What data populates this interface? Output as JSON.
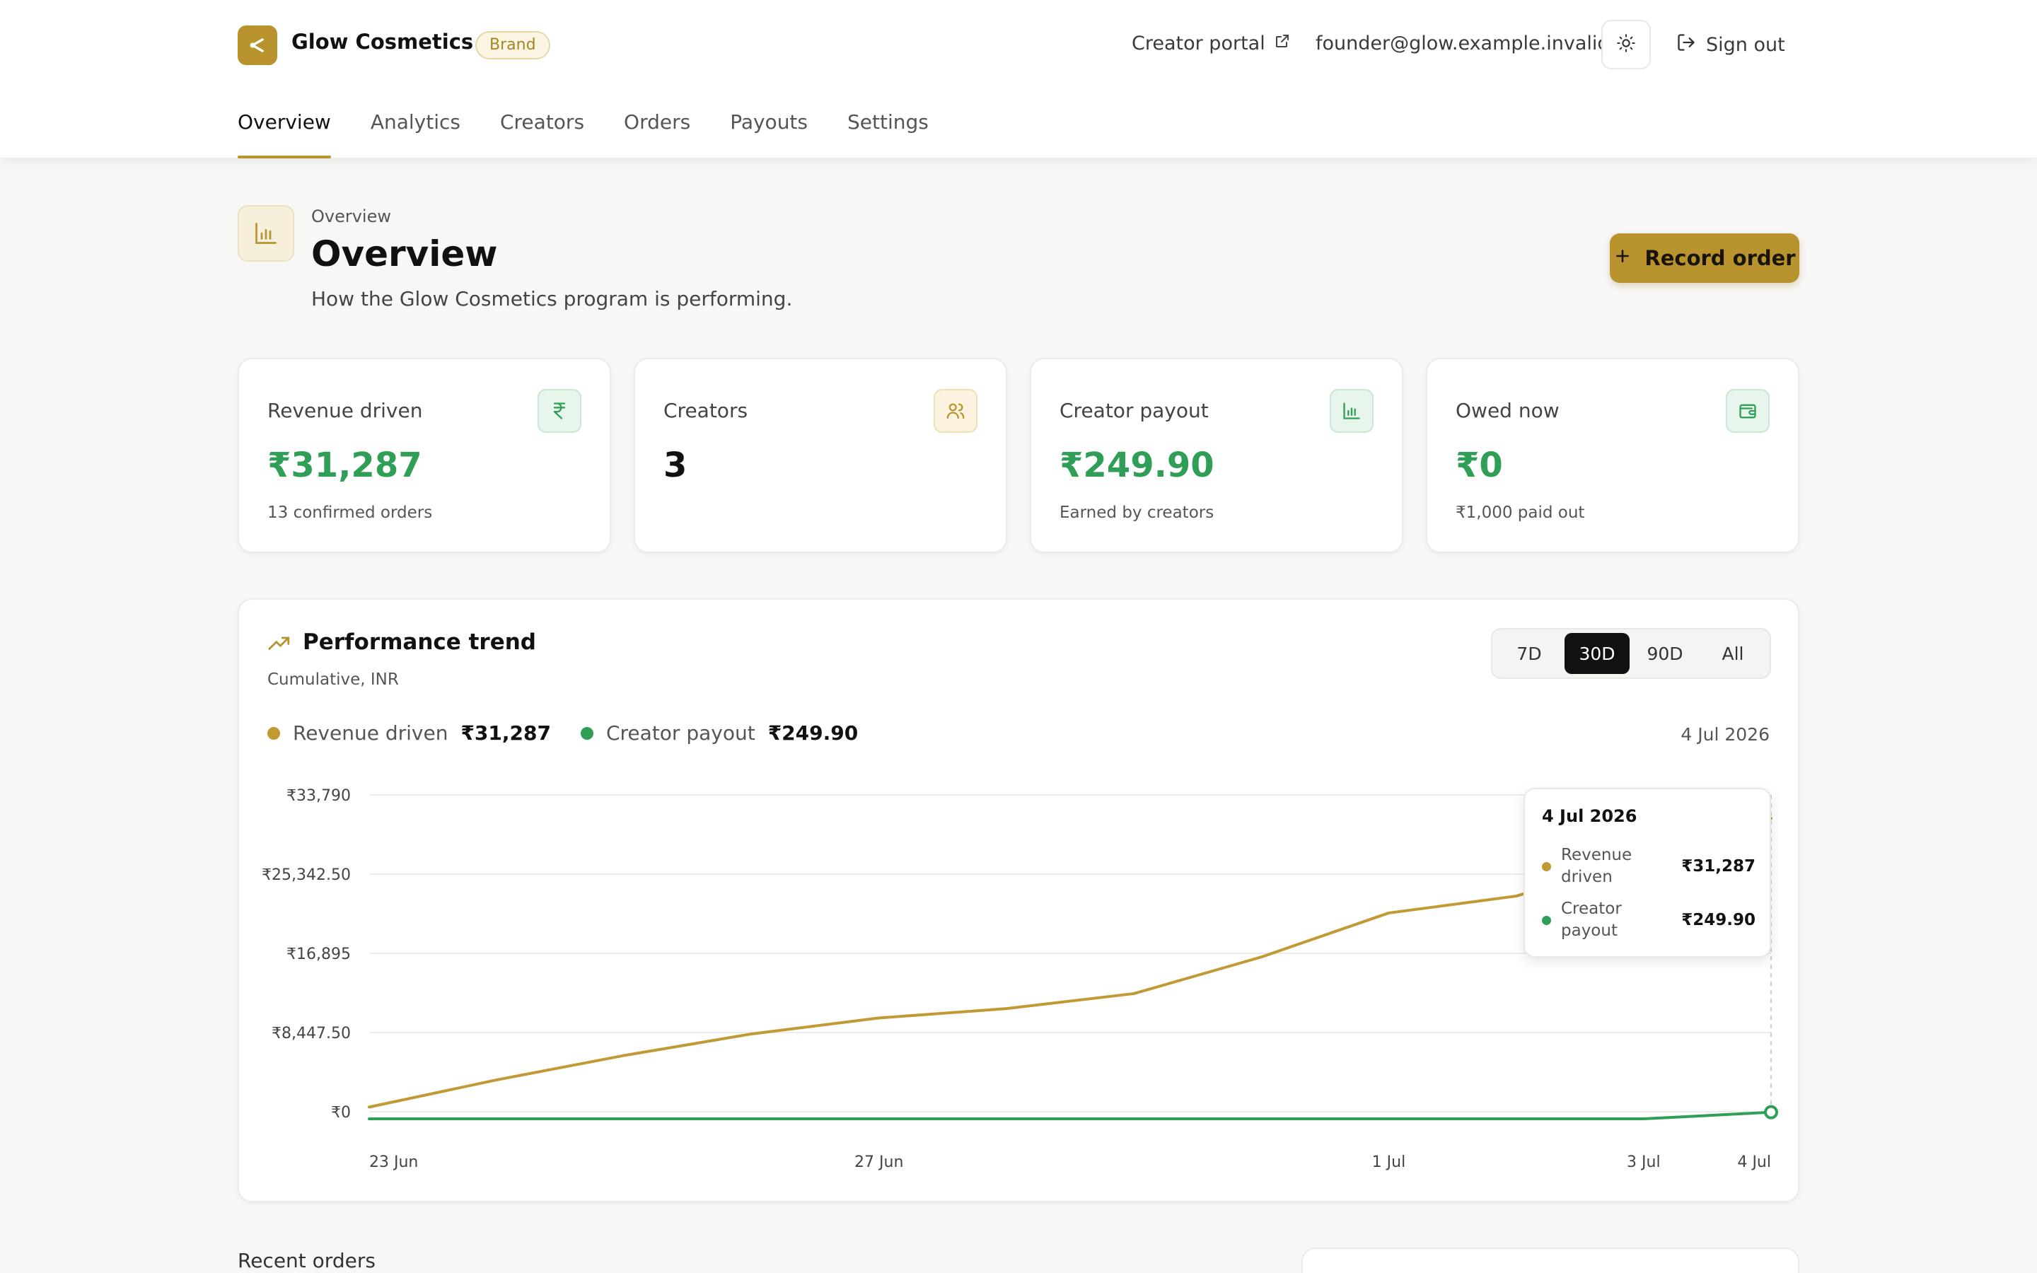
{
  "header": {
    "brand_name": "Glow Cosmetics",
    "brand_badge": "Brand",
    "creator_portal": "Creator portal",
    "user_email": "founder@glow.example.invalid",
    "sign_out": "Sign out",
    "accent_color": "#b8932e"
  },
  "tabs": [
    {
      "label": "Overview",
      "active": true
    },
    {
      "label": "Analytics",
      "active": false
    },
    {
      "label": "Creators",
      "active": false
    },
    {
      "label": "Orders",
      "active": false
    },
    {
      "label": "Payouts",
      "active": false
    },
    {
      "label": "Settings",
      "active": false
    }
  ],
  "page": {
    "breadcrumb": "Overview",
    "title": "Overview",
    "subtitle": "How the Glow Cosmetics program is performing.",
    "record_button": "Record order"
  },
  "stats": [
    {
      "label": "Revenue driven",
      "value": "₹31,287",
      "note": "13 confirmed orders",
      "icon": "rupee-icon"
    },
    {
      "label": "Creators",
      "value": "3",
      "note": "",
      "icon": "users-icon"
    },
    {
      "label": "Creator payout",
      "value": "₹249.90",
      "note": "Earned by creators",
      "icon": "bar-chart-icon"
    },
    {
      "label": "Owed now",
      "value": "₹0",
      "note": "₹1,000 paid out",
      "icon": "wallet-icon"
    }
  ],
  "trend": {
    "title": "Performance trend",
    "subtitle": "Cumulative, INR",
    "ranges": [
      {
        "label": "7D",
        "active": false
      },
      {
        "label": "30D",
        "active": true
      },
      {
        "label": "90D",
        "active": false
      },
      {
        "label": "All",
        "active": false
      }
    ],
    "legend": [
      {
        "name": "Revenue driven",
        "value": "₹31,287",
        "color": "#c19a35"
      },
      {
        "name": "Creator payout",
        "value": "₹249.90",
        "color": "#2f9e57"
      }
    ],
    "current_date": "4 Jul 2026",
    "tooltip": {
      "date": "4 Jul 2026",
      "rows": [
        {
          "name": "Revenue driven",
          "value": "₹31,287"
        },
        {
          "name": "Creator payout",
          "value": "₹249.90"
        }
      ]
    }
  },
  "chart_data": {
    "type": "line",
    "title": "Performance trend",
    "subtitle": "Cumulative, INR",
    "xlabel": "",
    "ylabel": "",
    "x_tick_labels": [
      "23 Jun",
      "27 Jun",
      "1 Jul",
      "3 Jul",
      "4 Jul"
    ],
    "y_tick_labels": [
      "₹0",
      "₹8,447.50",
      "₹16,895",
      "₹25,342.50",
      "₹33,790"
    ],
    "ylim": [
      0,
      33790
    ],
    "grid": true,
    "x": [
      "23 Jun",
      "24 Jun",
      "25 Jun",
      "26 Jun",
      "27 Jun",
      "28 Jun",
      "29 Jun",
      "30 Jun",
      "1 Jul",
      "2 Jul",
      "3 Jul",
      "4 Jul"
    ],
    "series": [
      {
        "name": "Revenue driven",
        "color": "#c19a35",
        "values": [
          500,
          3400,
          6000,
          8300,
          10000,
          11000,
          12600,
          16500,
          21200,
          23000,
          27100,
          31287
        ]
      },
      {
        "name": "Creator payout",
        "color": "#2f9e57",
        "values": [
          0,
          0,
          0,
          0,
          0,
          0,
          0,
          0,
          0,
          0,
          0,
          249.9
        ]
      }
    ]
  },
  "recent": {
    "title": "Recent orders"
  }
}
